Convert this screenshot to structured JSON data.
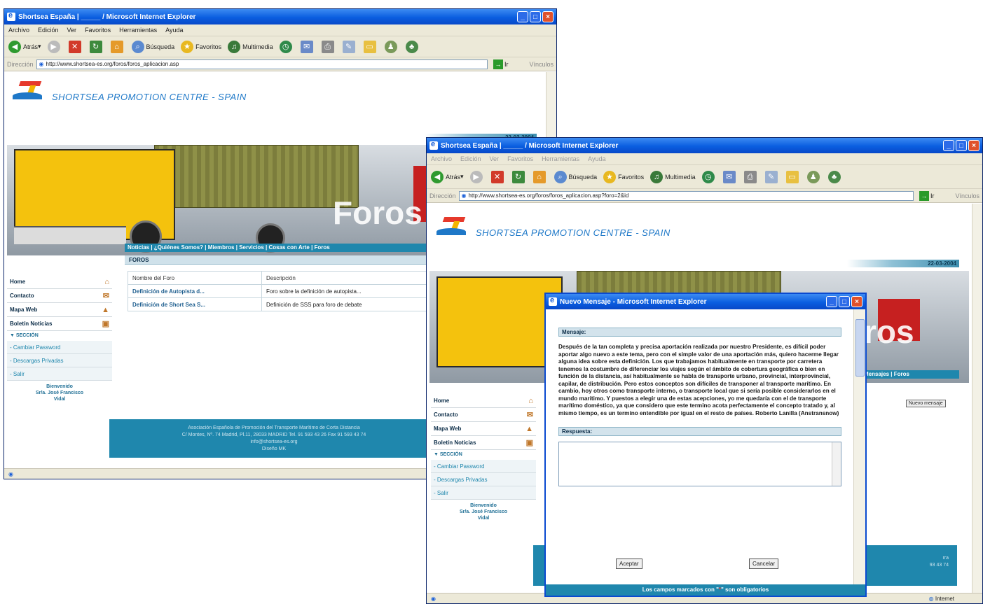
{
  "window1": {
    "title": "Shortsea España | _____ / Microsoft Internet Explorer",
    "menu": [
      "Archivo",
      "Edición",
      "Ver",
      "Favoritos",
      "Herramientas",
      "Ayuda"
    ],
    "toolbar": {
      "back": "Atrás",
      "search": "Búsqueda",
      "favorites": "Favoritos",
      "media": "Multimedia"
    },
    "address_label": "Dirección",
    "address_value": "http://www.shortsea-es.org/foros/foros_aplicacion.asp",
    "go_label": "Ir",
    "links_label": "Vínculos",
    "site_name": "SHORTSEA PROMOTION CENTRE - SPAIN",
    "date": "22-03-2004",
    "banner_word": "Foros",
    "nav_strip": "Noticias | ¿Quiénes Somos? | Miembros | Servicios | Cosas con Arte | Foros",
    "side_menu": [
      "Home",
      "Contacto",
      "Mapa Web",
      "Boletín Noticias"
    ],
    "section_label": "SECCIÓN",
    "side_sub": [
      "Cambiar Password",
      "Descargas Privadas",
      "Salir"
    ],
    "welcome": [
      "Bienvenido",
      "Sr/a. José Francisco",
      "Vidal"
    ],
    "foros_header": "FOROS",
    "table_headers": [
      "Nombre del Foro",
      "Descripción"
    ],
    "table_rows": [
      [
        "Definición de Autopista d...",
        "Foro sobre la definición de autopista..."
      ],
      [
        "Definición de Short Sea S...",
        "Definición de SSS para foro de debate"
      ]
    ],
    "footer_lines": [
      "Asociación Española de Promoción del Transporte Marítimo de Corta Distancia",
      "C/ Montes, Nº. 74 Madrid, Pl.11, 28033 MADRID Tel. 91 593 43 26 Fax 91 593 43 74",
      "info@shortsea-es.org",
      "Diseño MK"
    ]
  },
  "window2": {
    "title": "Shortsea España | _____ / Microsoft Internet Explorer",
    "menu": [
      "Archivo",
      "Edición",
      "Ver",
      "Favoritos",
      "Herramientas",
      "Ayuda"
    ],
    "toolbar": {
      "back": "Atrás",
      "search": "Búsqueda",
      "favorites": "Favoritos",
      "media": "Multimedia"
    },
    "address_label": "Dirección",
    "address_value": "http://www.shortsea-es.org/foros/foros_aplicacion.asp?foro=2&id",
    "go_label": "Ir",
    "links_label": "Vínculos",
    "site_name": "SHORTSEA PROMOTION CENTRE - SPAIN",
    "date": "22-03-2004",
    "banner_word": "ros",
    "nav_strip": "Mensajes | Foros",
    "side_menu": [
      "Home",
      "Contacto",
      "Mapa Web",
      "Boletín Noticias"
    ],
    "section_label": "SECCIÓN",
    "side_sub": [
      "Cambiar Password",
      "Descargas Privadas",
      "Salir"
    ],
    "welcome": [
      "Bienvenido",
      "Sr/a. José Francisco",
      "Vidal"
    ],
    "new_message_button": "Nuevo mensaje",
    "footer_fragment": [
      "rra",
      "93 43 74"
    ],
    "status": "Internet"
  },
  "dialog": {
    "title": "Nuevo Mensaje - Microsoft Internet Explorer",
    "message_header": "Mensaje:",
    "message_text": "Después de la tan completa y precisa aportación realizada por nuestro Presidente, es difícil poder aportar algo nuevo a este tema, pero con el simple valor de una aportación más, quiero hacerme llegar alguna idea sobre esta definición. Los que trabajamos habitualmente en transporte por carretera tenemos la costumbre de diferenciar los viajes según el ámbito de cobertura geográfica o bien en función de la distancia, así habitualmente se habla de transporte urbano, provincial, interprovincial, capilar, de distribución. Pero estos conceptos son difíciles de transponer al transporte marítimo. En cambio, hoy otros como transporte interno, o transporte local que si sería posible considerarlos en el mundo marítimo. Y puestos a elegir una de estas acepciones, yo me quedaría con el de transporte marítimo doméstico, ya que considero que este termino acota perfectamente el concepto tratado y, al mismo tiempo, es un termino entendible por igual en el resto de países. Roberto Lanilla (Anstransnow)",
    "reply_header": "Respuesta:",
    "accept_label": "Aceptar",
    "cancel_label": "Cancelar",
    "footer_prefix": "Los campos marcados con \"",
    "footer_star": "*",
    "footer_suffix": "\" son obligatorios"
  }
}
